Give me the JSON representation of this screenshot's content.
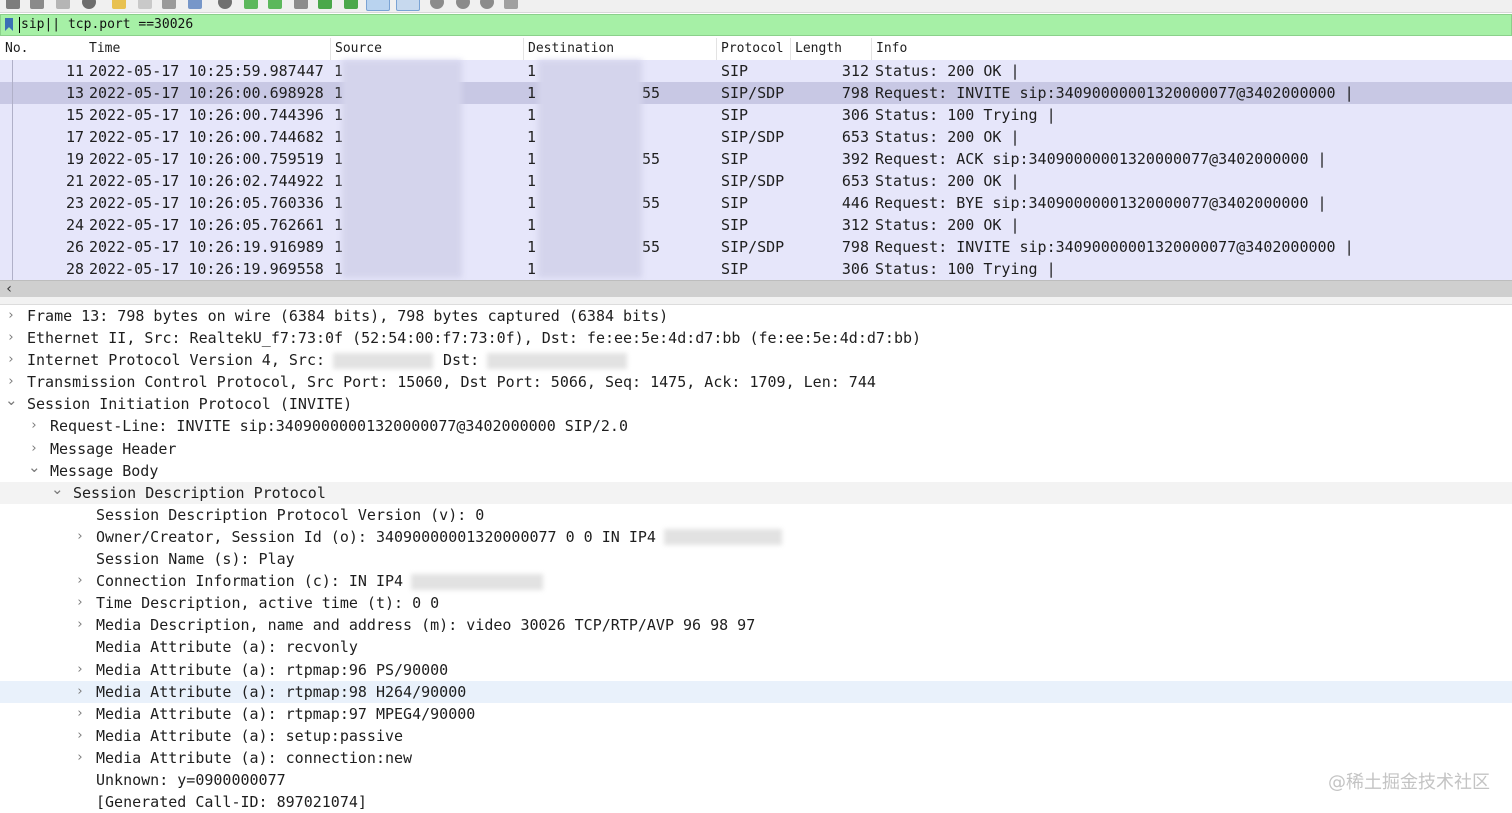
{
  "filter": {
    "value": "sip|| tcp.port ==30026"
  },
  "columns": [
    "No.",
    "Time",
    "Source",
    "Destination",
    "Protocol",
    "Length",
    "Info"
  ],
  "packets": [
    {
      "no": "11",
      "time": "2022-05-17 10:25:59.987447",
      "src": "1",
      "dst": "1",
      "dst_tail": "",
      "proto": "SIP",
      "len": "312",
      "info": "Status: 200 OK |"
    },
    {
      "no": "13",
      "time": "2022-05-17 10:26:00.698928",
      "src": "1",
      "dst": "1",
      "dst_tail": "55",
      "proto": "SIP/SDP",
      "len": "798",
      "info": "Request: INVITE sip:34090000001320000077@3402000000 |"
    },
    {
      "no": "15",
      "time": "2022-05-17 10:26:00.744396",
      "src": "1",
      "dst": "1",
      "dst_tail": "",
      "proto": "SIP",
      "len": "306",
      "info": "Status: 100 Trying |"
    },
    {
      "no": "17",
      "time": "2022-05-17 10:26:00.744682",
      "src": "1",
      "dst": "1",
      "dst_tail": "",
      "proto": "SIP/SDP",
      "len": "653",
      "info": "Status: 200 OK |"
    },
    {
      "no": "19",
      "time": "2022-05-17 10:26:00.759519",
      "src": "1",
      "dst": "1",
      "dst_tail": "55",
      "proto": "SIP",
      "len": "392",
      "info": "Request: ACK sip:34090000001320000077@3402000000 |"
    },
    {
      "no": "21",
      "time": "2022-05-17 10:26:02.744922",
      "src": "1",
      "dst": "1",
      "dst_tail": "",
      "proto": "SIP/SDP",
      "len": "653",
      "info": "Status: 200 OK |"
    },
    {
      "no": "23",
      "time": "2022-05-17 10:26:05.760336",
      "src": "1",
      "dst": "1",
      "dst_tail": "55",
      "proto": "SIP",
      "len": "446",
      "info": "Request: BYE sip:34090000001320000077@3402000000 |"
    },
    {
      "no": "24",
      "time": "2022-05-17 10:26:05.762661",
      "src": "1",
      "dst": "1",
      "dst_tail": "",
      "proto": "SIP",
      "len": "312",
      "info": "Status: 200 OK |"
    },
    {
      "no": "26",
      "time": "2022-05-17 10:26:19.916989",
      "src": "1",
      "dst": "1",
      "dst_tail": "55",
      "proto": "SIP/SDP",
      "len": "798",
      "info": "Request: INVITE sip:34090000001320000077@3402000000 |"
    },
    {
      "no": "28",
      "time": "2022-05-17 10:26:19.969558",
      "src": "1",
      "dst": "1",
      "dst_tail": "",
      "proto": "SIP",
      "len": "306",
      "info": "Status: 100 Trying |"
    }
  ],
  "selected_packet_index": 1,
  "details": [
    {
      "level": 0,
      "arrow": "collapsed",
      "text": "Frame 13: 798 bytes on wire (6384 bits), 798 bytes captured (6384 bits)"
    },
    {
      "level": 0,
      "arrow": "collapsed",
      "text": "Ethernet II, Src: RealtekU_f7:73:0f (52:54:00:f7:73:0f), Dst: fe:ee:5e:4d:d7:bb (fe:ee:5e:4d:d7:bb)"
    },
    {
      "level": 0,
      "arrow": "collapsed",
      "text": "Internet Protocol Version 4, Src:",
      "redacted_a": true,
      "text2": "Dst:",
      "redacted_b": true
    },
    {
      "level": 0,
      "arrow": "collapsed",
      "text": "Transmission Control Protocol, Src Port: 15060, Dst Port: 5066, Seq: 1475, Ack: 1709, Len: 744"
    },
    {
      "level": 0,
      "arrow": "expanded",
      "text": "Session Initiation Protocol (INVITE)"
    },
    {
      "level": 1,
      "arrow": "collapsed",
      "text": "Request-Line: INVITE sip:34090000001320000077@3402000000 SIP/2.0"
    },
    {
      "level": 1,
      "arrow": "collapsed",
      "text": "Message Header"
    },
    {
      "level": 1,
      "arrow": "expanded",
      "text": "Message Body"
    },
    {
      "level": 2,
      "arrow": "expanded",
      "text": "Session Description Protocol",
      "band": true
    },
    {
      "level": 3,
      "arrow": "none",
      "text": "Session Description Protocol Version (v): 0"
    },
    {
      "level": 3,
      "arrow": "collapsed",
      "text": "Owner/Creator, Session Id (o): 34090000001320000077 0 0 IN IP4",
      "redacted_a": true
    },
    {
      "level": 3,
      "arrow": "none",
      "text": "Session Name (s): Play"
    },
    {
      "level": 3,
      "arrow": "collapsed",
      "text": "Connection Information (c): IN IP4",
      "redacted_a": true
    },
    {
      "level": 3,
      "arrow": "collapsed",
      "text": "Time Description, active time (t): 0 0"
    },
    {
      "level": 3,
      "arrow": "collapsed",
      "text": "Media Description, name and address (m): video 30026 TCP/RTP/AVP 96 98 97"
    },
    {
      "level": 3,
      "arrow": "none",
      "text": "Media Attribute (a): recvonly"
    },
    {
      "level": 3,
      "arrow": "collapsed",
      "text": "Media Attribute (a): rtpmap:96 PS/90000"
    },
    {
      "level": 3,
      "arrow": "collapsed",
      "text": "Media Attribute (a): rtpmap:98 H264/90000",
      "highlight": true
    },
    {
      "level": 3,
      "arrow": "collapsed",
      "text": "Media Attribute (a): rtpmap:97 MPEG4/90000"
    },
    {
      "level": 3,
      "arrow": "collapsed",
      "text": "Media Attribute (a): setup:passive"
    },
    {
      "level": 3,
      "arrow": "collapsed",
      "text": "Media Attribute (a): connection:new"
    },
    {
      "level": 3,
      "arrow": "none",
      "text": "Unknown: y=0900000077"
    },
    {
      "level": 3,
      "arrow": "none",
      "text": "[Generated Call-ID: 897021074]"
    }
  ],
  "watermark": "@稀土掘金技术社区",
  "colors": {
    "filter_bg": "#a6f0a6",
    "row_bg": "#e6e6fa",
    "row_selected": "#c8c8e4",
    "tree_highlight": "#e9f1fb"
  }
}
